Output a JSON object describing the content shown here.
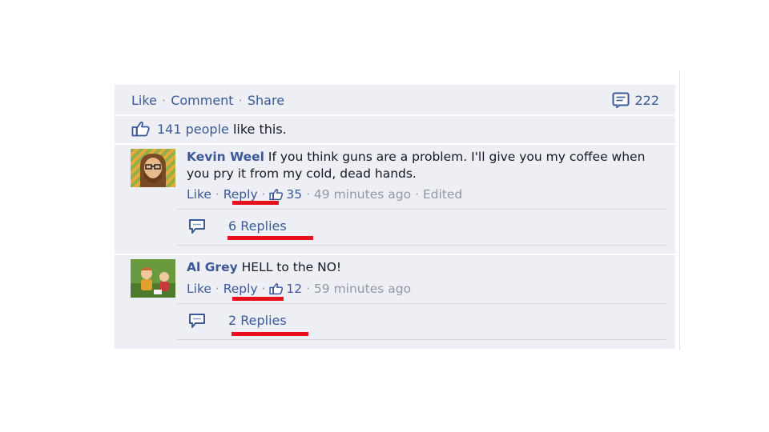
{
  "actions_bar": {
    "like": "Like",
    "sep1": "·",
    "comment": "Comment",
    "sep2": "·",
    "share": "Share",
    "comment_count": "222"
  },
  "likes": {
    "count_text": "141 people",
    "suffix": " like this."
  },
  "comments": [
    {
      "author": "Kevin Weel",
      "text": " If you think guns are a problem. I'll give you my coffee when you pry it from my cold, dead hands.",
      "like": "Like",
      "sep1": " · ",
      "reply": "Reply",
      "sep2": " · ",
      "likes": "35",
      "sep3": " · ",
      "time": "49 minutes ago",
      "sep4": " · ",
      "edited": "Edited",
      "replies": "6 Replies"
    },
    {
      "author": "Al Grey",
      "text": " HELL to the NO!",
      "like": "Like",
      "sep1": " · ",
      "reply": "Reply",
      "sep2": " · ",
      "likes": "12",
      "sep3": " · ",
      "time": "59 minutes ago",
      "replies": "2 Replies"
    }
  ],
  "colors": {
    "link": "#3b5998",
    "panel": "#edeff4",
    "highlight": "#e8101c"
  },
  "icons": [
    "comment-count-icon",
    "thumbs-up-icon",
    "reply-bubble-icon"
  ]
}
